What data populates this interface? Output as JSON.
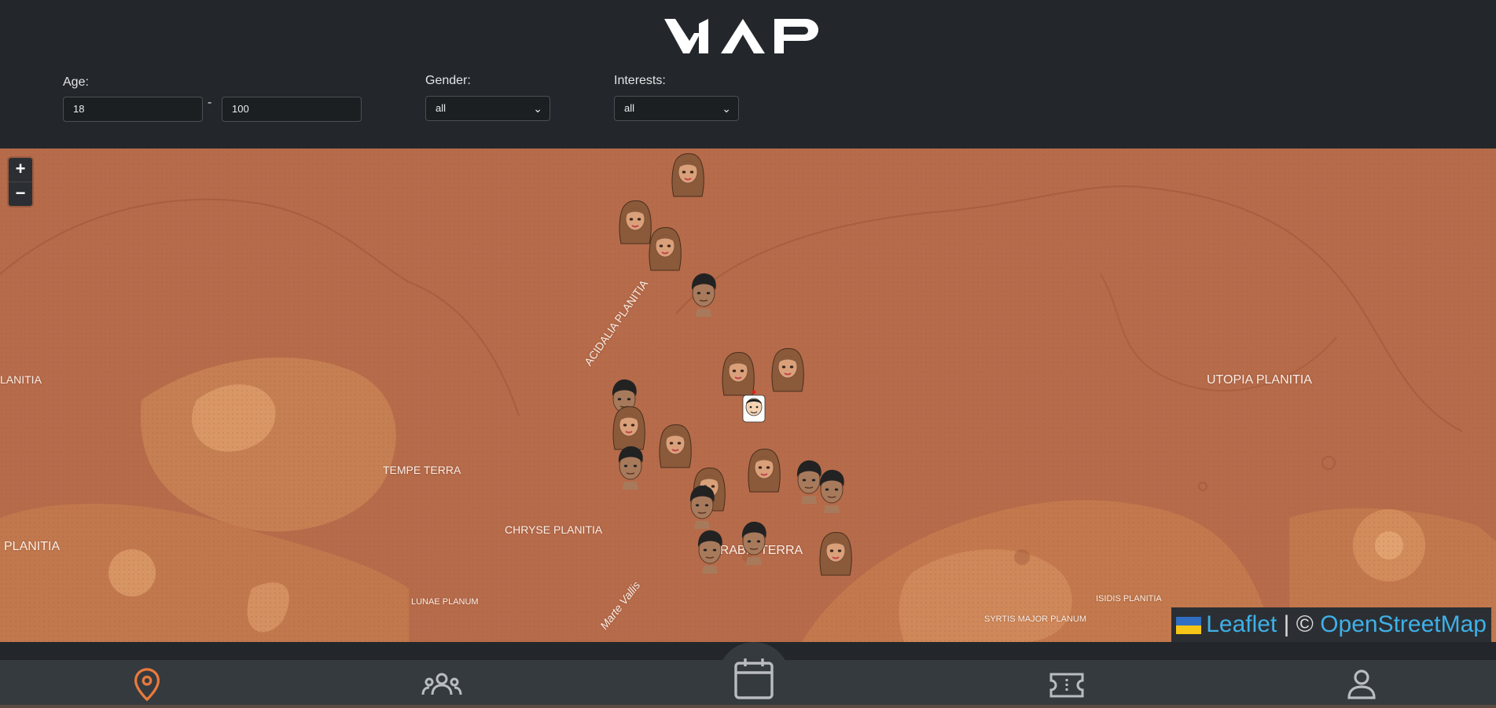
{
  "header": {
    "logo_text": "MAP",
    "filters": {
      "age": {
        "label": "Age:",
        "min_value": "18",
        "separator": "-",
        "max_value": "100"
      },
      "gender": {
        "label": "Gender:",
        "selected": "all"
      },
      "interests": {
        "label": "Interests:",
        "selected": "all"
      }
    }
  },
  "map": {
    "zoom_in_label": "+",
    "zoom_out_label": "−",
    "labels": {
      "planitia_left": "LANITIA",
      "acidalia": "ACIDALIA PLANITIA",
      "utopia": "UTOPIA PLANITIA",
      "tempe": "TEMPE TERRA",
      "chryse": "CHRYSE PLANITIA",
      "planitia_left2": "PLANITIA",
      "arabia": "ARABIA TERRA",
      "lunae": "LUNAE PLANUM",
      "marte": "Marte Vallis",
      "syrtis": "SYRTIS MAJOR PLANUM",
      "isidis": "ISIDIS PLANITIA"
    },
    "attribution": {
      "leaflet": "Leaflet",
      "separator": " | © ",
      "osm": "OpenStreetMap"
    },
    "marker_kinds": [
      "female-avatar",
      "male-avatar",
      "self-avatar"
    ]
  },
  "bottom_nav": {
    "items": [
      "map-pin-icon",
      "people-icon",
      "calendar-icon",
      "ticket-icon",
      "user-icon"
    ],
    "active_color": "#e97a3c",
    "inactive_color": "#b9bcc0"
  }
}
